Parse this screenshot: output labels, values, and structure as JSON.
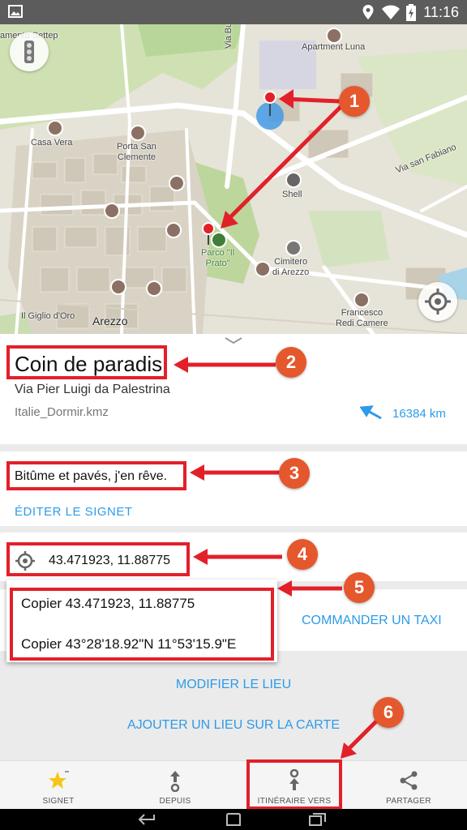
{
  "status_bar": {
    "time": "11:16"
  },
  "map": {
    "labels": {
      "apartment": "Apartment Luna",
      "casa_vera": "Casa Vera",
      "porta_san": "Porta San\nClemente",
      "via_buonco": "Via Buonco",
      "via_san_fabiano": "Via san Fabiano",
      "shell": "Shell",
      "parco": "Parco \"Il\nPrato\"",
      "cimitero": "Cimitero\ndi Arezzo",
      "il_giglio": "Il Giglio d'Oro",
      "arezzo": "Arezzo",
      "francesco": "Francesco\nRedi Camere",
      "amento": "amento\nSettep"
    }
  },
  "place": {
    "name": "Coin de paradis",
    "address": "Via Pier Luigi da Palestrina",
    "file": "Italie_Dormir.kmz",
    "distance": "16384 km"
  },
  "note": {
    "text": "Bitûme et pavés, j'en rêve.",
    "edit_label": "ÉDITER LE SIGNET"
  },
  "coords": {
    "value": "43.471923, 11.88775"
  },
  "popup": {
    "copy_decimal": "Copier 43.471923, 11.88775",
    "copy_dms": "Copier 43°28'18.92\"N 11°53'15.9\"E"
  },
  "actions": {
    "taxi": "COMMANDER UN TAXI",
    "modify_place": "MODIFIER LE LIEU",
    "add_place": "AJOUTER UN LIEU SUR LA CARTE"
  },
  "tabs": {
    "bookmark": "SIGNET",
    "from": "DEPUIS",
    "route_to": "ITINÉRAIRE VERS",
    "share": "PARTAGER"
  },
  "badges": [
    "1",
    "2",
    "3",
    "4",
    "5",
    "6"
  ],
  "colors": {
    "accent": "#2d9be8",
    "annotation_red": "#e2202a",
    "badge_orange": "#e5572c",
    "star": "#f5c518"
  }
}
